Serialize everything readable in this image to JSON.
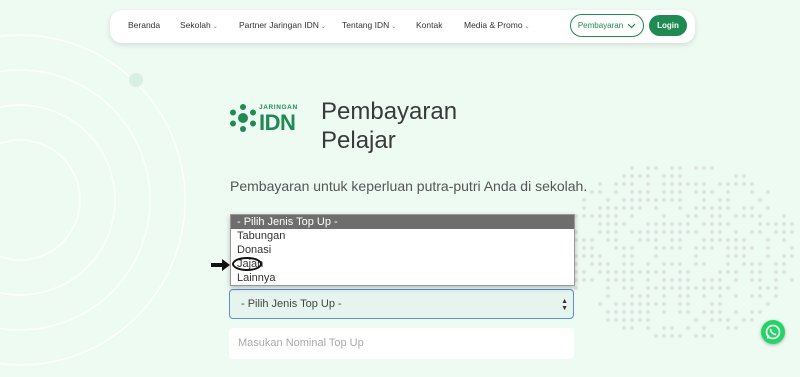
{
  "nav": {
    "items": [
      "Beranda",
      "Sekolah",
      "Partner Jaringan IDN",
      "Tentang IDN",
      "Kontak",
      "Media & Promo"
    ],
    "pay_button": "Pembayaran",
    "login_button": "Login"
  },
  "logo": {
    "small": "JARINGAN",
    "big": "IDN"
  },
  "page": {
    "title_line1": "Pembayaran",
    "title_line2": "Pelajar",
    "subtitle": "Pembayaran untuk keperluan putra-putri Anda di sekolah."
  },
  "dropdown": {
    "options": [
      "- Pilih Jenis Top Up -",
      "Tabungan",
      "Donasi",
      "Jajan",
      "Lainnya"
    ],
    "selected_index": 0
  },
  "select": {
    "value": "- Pilih Jenis Top Up -"
  },
  "nominal": {
    "placeholder": "Masukan Nominal Top Up"
  },
  "colors": {
    "brand": "#1f8a52",
    "background": "#eefbf3",
    "whatsapp": "#25d366"
  }
}
